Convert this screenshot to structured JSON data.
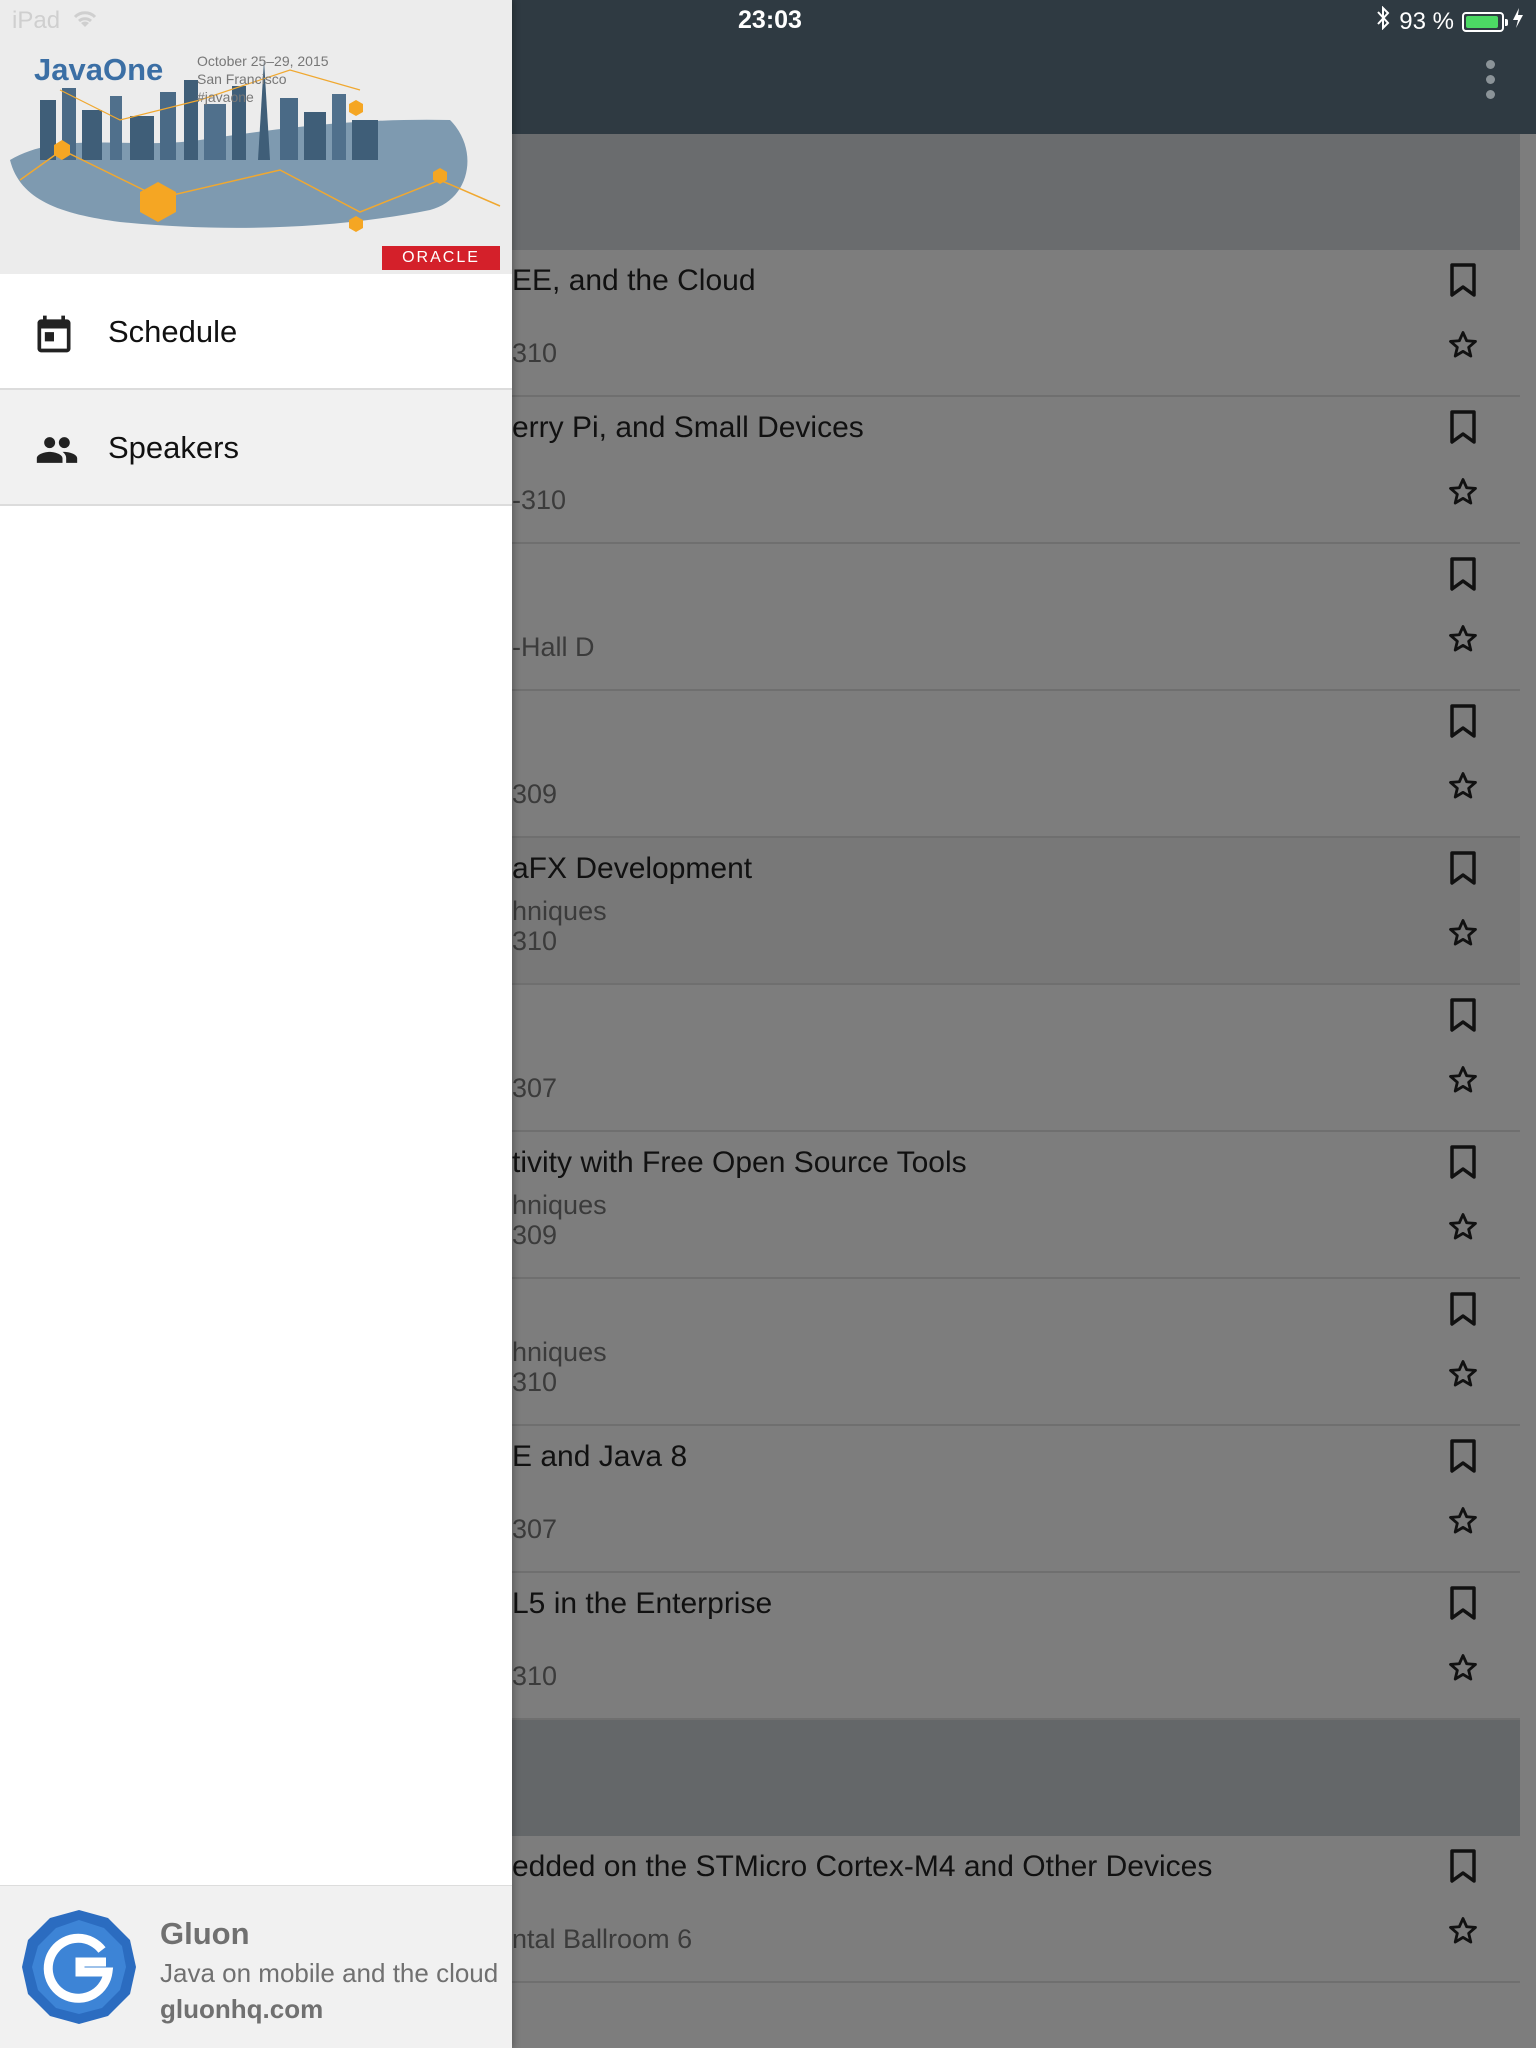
{
  "status_bar": {
    "device": "iPad",
    "time": "23:03",
    "battery_text": "93 %",
    "battery_level": 0.93
  },
  "drawer": {
    "banner": {
      "logo_text": "JavaOne",
      "date_lines": [
        "October 25–29, 2015",
        "San Francisco",
        "#javaone"
      ],
      "sponsor": "ORACLE"
    },
    "nav_items": [
      {
        "label": "Schedule",
        "icon": "calendar-icon"
      },
      {
        "label": "Speakers",
        "icon": "people-icon"
      }
    ],
    "footer": {
      "name": "Gluon",
      "tagline": "Java on mobile and the cloud",
      "url": "gluonhq.com"
    }
  },
  "list": {
    "rows": [
      {
        "title": "EE, and the Cloud",
        "subtitle": "",
        "room": "310"
      },
      {
        "title": "erry Pi, and Small Devices",
        "subtitle": "",
        "room": "-310"
      },
      {
        "title": "",
        "subtitle": "",
        "room": "-Hall D"
      },
      {
        "title": "",
        "subtitle": "",
        "room": "309"
      },
      {
        "title": "aFX Development",
        "subtitle": "hniques",
        "room": "310"
      },
      {
        "title": "",
        "subtitle": "",
        "room": "307"
      },
      {
        "title": "tivity with Free Open Source Tools",
        "subtitle": "hniques",
        "room": "309"
      },
      {
        "title": "",
        "subtitle": "hniques",
        "room": "310"
      },
      {
        "title": "E and Java 8",
        "subtitle": "",
        "room": "307"
      },
      {
        "title": "L5 in the Enterprise",
        "subtitle": "",
        "room": "310"
      }
    ],
    "rows_after": [
      {
        "title": "edded on the STMicro Cortex-M4 and Other Devices",
        "subtitle": "",
        "room": "ntal Ballroom 6"
      }
    ]
  }
}
